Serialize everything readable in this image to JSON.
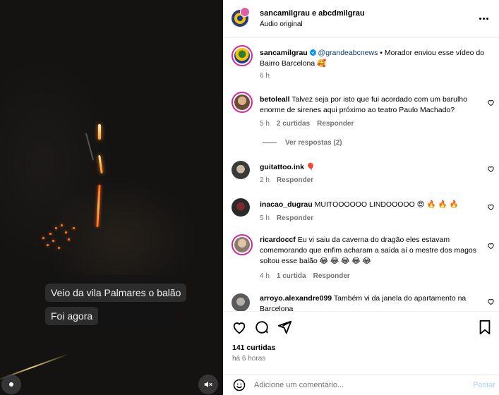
{
  "post": {
    "author": "sancamilgrau",
    "collab_title": "sancamilgrau e abcdmilgrau",
    "audio": "Áudio original",
    "more_icon": "more-horizontal-icon"
  },
  "video": {
    "chat_lines": [
      "Veio da vila Palmares o balão",
      "Foi agora"
    ],
    "mute_icon": "muted-speaker-icon"
  },
  "caption": {
    "username": "sancamilgrau",
    "mention": "@grandeabcnews",
    "text": " • Morador enviou esse vídeo do Bairro Barcelona 🥰",
    "time": "6 h"
  },
  "comments": [
    {
      "username": "betoleall",
      "text": "Talvez seja por isto que fui acordado com um barulho enorme de sirenes aqui próximo ao teatro Paulo Machado?",
      "time": "5 h",
      "likes": "2 curtidas",
      "reply": "Responder",
      "view_replies": "Ver respostas (2)"
    },
    {
      "username": "guitattoo.ink",
      "text": "🎈",
      "time": "2 h",
      "reply": "Responder"
    },
    {
      "username": "inacao_dugrau",
      "text": "MUITOOOOOO LINDOOOOO 😍 🔥 🔥 🔥",
      "time": "5 h",
      "reply": "Responder"
    },
    {
      "username": "ricardoccf",
      "text": "Eu vi saiu da caverna do dragão eles estavam comemorando que enfim acharam a saída aí o mestre dos magos soltou esse balão 😂 😂 😂 😂 😂",
      "time": "4 h",
      "likes": "1 curtida",
      "reply": "Responder"
    },
    {
      "username": "arroyo.alexandre099",
      "text": "Também vi da janela do apartamento na Barcelona"
    }
  ],
  "actions": {
    "likes": "141 curtidas",
    "date": "há 6 horas"
  },
  "composer": {
    "placeholder": "Adicione um comentário...",
    "post_label": "Postar"
  },
  "colors": {
    "accent_blue": "#0095f6",
    "link": "#00376b",
    "muted": "#737373",
    "verified": "#0095f6"
  }
}
